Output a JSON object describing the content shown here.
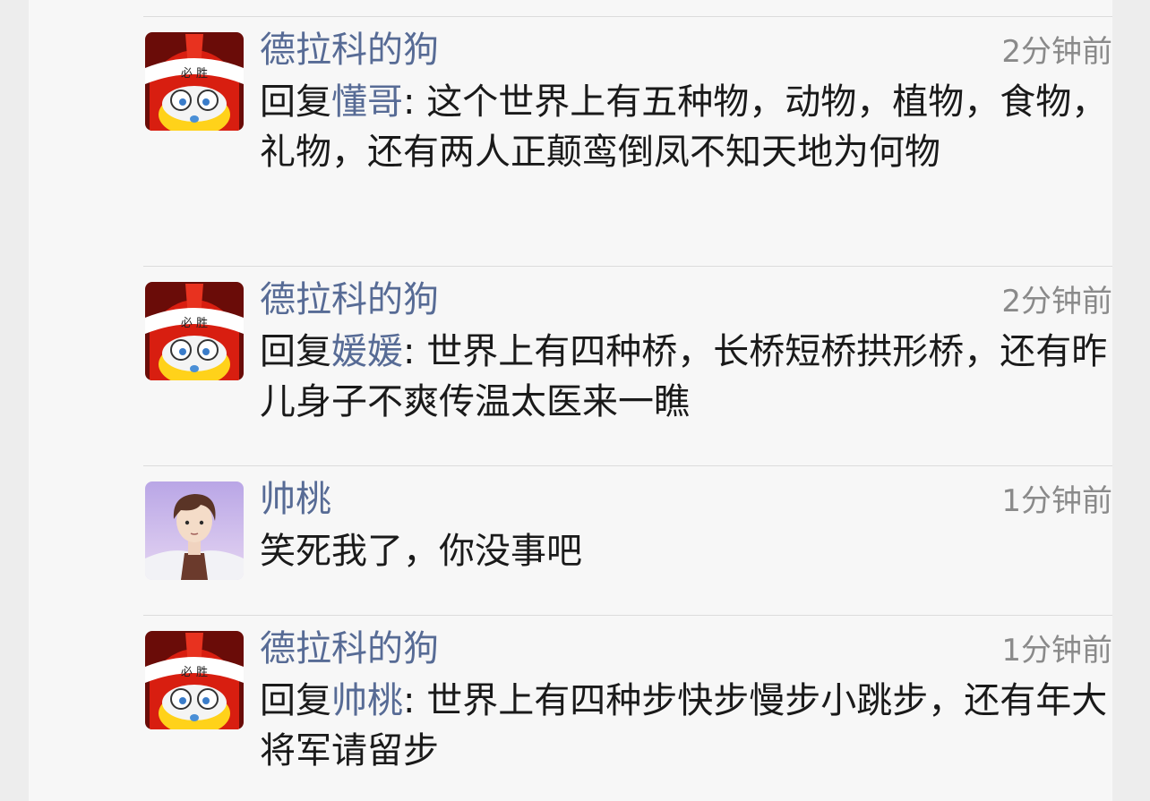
{
  "comments": [
    {
      "author": "德拉科的狗",
      "time": "2分钟前",
      "reply_prefix": "回复",
      "reply_to": "懂哥",
      "separator": ": ",
      "text": "这个世界上有五种物，动物，植物，食物，礼物，还有两人正颠鸾倒凤不知天地为何物",
      "avatar": "helmet-avatar"
    },
    {
      "author": "德拉科的狗",
      "time": "2分钟前",
      "reply_prefix": "回复",
      "reply_to": "媛媛",
      "separator": ": ",
      "text": "世界上有四种桥，长桥短桥拱形桥，还有昨儿身子不爽传温太医来一瞧",
      "avatar": "helmet-avatar"
    },
    {
      "author": "帅桃",
      "time": "1分钟前",
      "text": "笑死我了，你没事吧",
      "avatar": "anime-boy-avatar"
    },
    {
      "author": "德拉科的狗",
      "time": "1分钟前",
      "reply_prefix": "回复",
      "reply_to": "帅桃",
      "separator": ": ",
      "text": "世界上有四种步快步慢步小跳步，还有年大将军请留步",
      "avatar": "helmet-avatar"
    }
  ],
  "helmet_headband_text": "必 胜",
  "colors": {
    "name": "#576b95",
    "text": "#1a1a1a",
    "time": "#8a8a8a",
    "background": "#f7f7f7"
  }
}
